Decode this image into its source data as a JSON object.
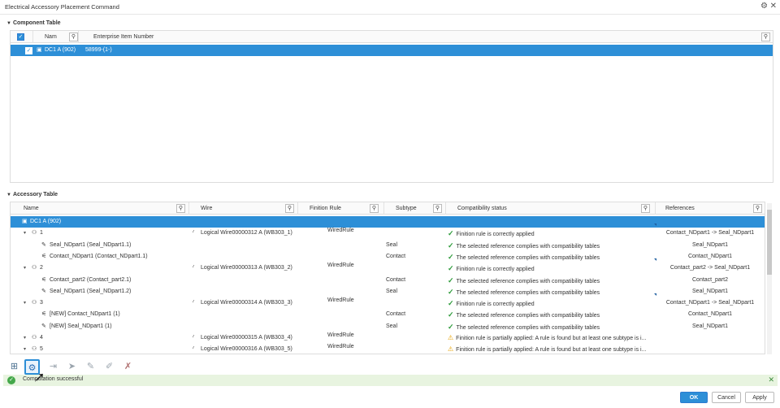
{
  "window": {
    "title": "Electrical Accessory Placement Command"
  },
  "component_table": {
    "section_title": "Component Table",
    "columns": [
      "Nam",
      "Enterprise Item Number"
    ],
    "rows": [
      {
        "name": "DC1 A (902)",
        "item_number": "58999-(1-)"
      }
    ]
  },
  "accessory_table": {
    "section_title": "Accessory Table",
    "columns": [
      "Name",
      "Wire",
      "Finition Rule",
      "Subtype",
      "Compatibility status",
      "References"
    ],
    "rows": [
      {
        "name": "DC1 A (902)",
        "wire": "",
        "rule": "",
        "subtype": "",
        "status": "",
        "status_type": "",
        "ref": "",
        "ref2": "",
        "level": 0,
        "icon": "connector-icon",
        "selected": true
      },
      {
        "name": "1",
        "wire": "Logical Wire00000312 A (WB303_1)",
        "rule": "WiredRule",
        "subtype": "",
        "status": "Finition rule is correctly applied",
        "status_type": "ok",
        "ref": "Contact_NDpart1 -> Seal_NDpart1",
        "ref2": "",
        "level": 1,
        "icon": "wire-group-icon"
      },
      {
        "name": "Seal_NDpart1 (Seal_NDpart1.1)",
        "wire": "",
        "rule": "",
        "subtype": "Seal",
        "status": "The selected reference complies with compatibility tables",
        "status_type": "ok",
        "ref": "Seal_NDpart1",
        "ref2": "",
        "level": 2,
        "icon": "seal-icon"
      },
      {
        "name": "Contact_NDpart1 (Contact_NDpart1.1)",
        "wire": "",
        "rule": "",
        "subtype": "Contact",
        "status": "The selected reference complies with compatibility tables",
        "status_type": "ok",
        "ref": "Contact_NDpart1",
        "ref2": "",
        "level": 2,
        "icon": "contact-icon"
      },
      {
        "name": "2",
        "wire": "Logical Wire00000313 A (WB303_2)",
        "rule": "WiredRule",
        "subtype": "",
        "status": "Finition rule is correctly applied",
        "status_type": "ok",
        "ref": "Contact_part2 -> Seal_NDpart1",
        "ref2": "",
        "level": 1,
        "icon": "wire-group-icon"
      },
      {
        "name": "Contact_part2 (Contact_part2.1)",
        "wire": "",
        "rule": "",
        "subtype": "Contact",
        "status": "The selected reference complies with compatibility tables",
        "status_type": "ok",
        "ref": "Contact_part2",
        "ref2": "",
        "level": 2,
        "icon": "contact-icon"
      },
      {
        "name": "Seal_NDpart1 (Seal_NDpart1.2)",
        "wire": "",
        "rule": "",
        "subtype": "Seal",
        "status": "The selected reference complies with compatibility tables",
        "status_type": "ok",
        "ref": "Seal_NDpart1",
        "ref2": "",
        "level": 2,
        "icon": "seal-icon"
      },
      {
        "name": "3",
        "wire": "Logical Wire00000314 A (WB303_3)",
        "rule": "WiredRule",
        "subtype": "",
        "status": "Finition rule is correctly applied",
        "status_type": "ok",
        "ref": "Contact_NDpart1 -> Seal_NDpart1",
        "ref2": "",
        "level": 1,
        "icon": "wire-group-icon"
      },
      {
        "name": "[NEW] Contact_NDpart1 (1)",
        "wire": "",
        "rule": "",
        "subtype": "Contact",
        "status": "The selected reference complies with compatibility tables",
        "status_type": "ok",
        "ref": "Contact_NDpart1",
        "ref2": "",
        "level": 2,
        "icon": "contact-icon"
      },
      {
        "name": "[NEW] Seal_NDpart1 (1)",
        "wire": "",
        "rule": "",
        "subtype": "Seal",
        "status": "The selected reference complies with compatibility tables",
        "status_type": "ok",
        "ref": "Seal_NDpart1",
        "ref2": "",
        "level": 2,
        "icon": "seal-icon"
      },
      {
        "name": "4",
        "wire": "Logical Wire00000315 A (WB303_4)",
        "rule": "WiredRule",
        "subtype": "",
        "status": "Finition rule is partially applied: A rule is found but at least one subtype is i...",
        "status_type": "warn",
        "ref": "",
        "ref2": "",
        "level": 1,
        "icon": "wire-group-icon"
      },
      {
        "name": "5",
        "wire": "Logical Wire00000316 A (WB303_5)",
        "rule": "WiredRule",
        "subtype": "",
        "status": "Finition rule is partially applied: A rule is found but at least one subtype is i...",
        "status_type": "warn",
        "ref": "",
        "ref2": "",
        "level": 1,
        "icon": "wire-group-icon"
      }
    ]
  },
  "toolbar": {
    "buttons": [
      "add-component-icon",
      "auto-place-icon",
      "place-contact-icon",
      "place-seal-icon",
      "place-plug-icon",
      "place-accessory-icon",
      "remove-accessory-icon"
    ]
  },
  "status": {
    "message": "Computation successful"
  },
  "buttons": {
    "ok": "OK",
    "cancel": "Cancel",
    "apply": "Apply"
  }
}
